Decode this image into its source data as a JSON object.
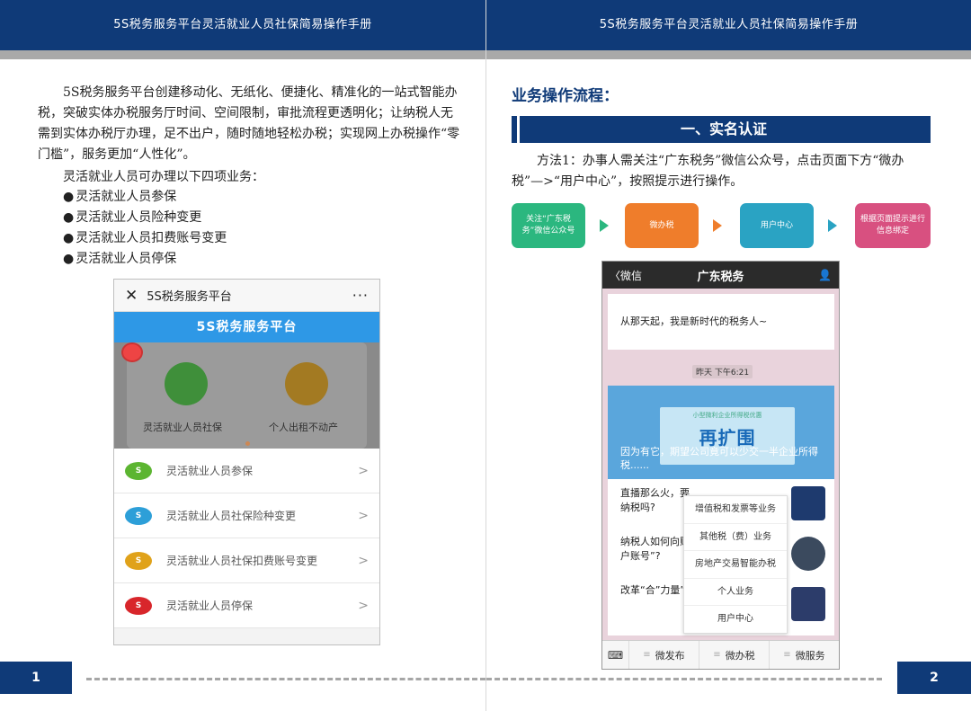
{
  "header": {
    "title": "5S税务服务平台灵活就业人员社保简易操作手册"
  },
  "left_page": {
    "intro": "5S税务服务平台创建移动化、无纸化、便捷化、精准化的一站式智能办税，突破实体办税服务厅时间、空间限制，审批流程更透明化；让纳税人无需到实体办税厅办理，足不出户，随时随地轻松办税；实现网上办税操作“零门槛”，服务更加“人性化”。",
    "lead": "灵活就业人员可办理以下四项业务：",
    "bullets": [
      "灵活就业人员参保",
      "灵活就业人员险种变更",
      "灵活就业人员扣费账号变更",
      "灵活就业人员停保"
    ],
    "page_number": "1"
  },
  "phone1": {
    "close": "✕",
    "title": "5S税务服务平台",
    "more": "···",
    "banner": "5S税务服务平台",
    "hero_labels": [
      "灵活就业人员社保",
      "个人出租不动产"
    ],
    "rows": [
      {
        "label": "灵活就业人员参保",
        "color": "#5cb531"
      },
      {
        "label": "灵活就业人员社保险种变更",
        "color": "#2d9fd8"
      },
      {
        "label": "灵活就业人员社保扣费账号变更",
        "color": "#e0a21a"
      },
      {
        "label": "灵活就业人员停保",
        "color": "#d8262b"
      }
    ]
  },
  "right_page": {
    "section_label": "业务操作流程：",
    "section_bar": "一、实名认证",
    "method": "方法1：办事人需关注“广东税务”微信公众号，点击页面下方“微办税”—>“用户中心”，按照提示进行操作。",
    "flow": [
      {
        "label": "关注“广东税务”微信公众号",
        "color": "#2bb77f"
      },
      {
        "label": "微办税",
        "color": "#ef7d2b"
      },
      {
        "label": "用户中心",
        "color": "#2aa3c3"
      },
      {
        "label": "根据页面提示进行信息绑定",
        "color": "#d85080"
      }
    ],
    "page_number": "2"
  },
  "phone2": {
    "back": "〈微信",
    "title": "广东税务",
    "user_icon": "user-icon",
    "msg1": "从那天起，我是新时代的税务人~",
    "time": "昨天 下午6:21",
    "promo_small": "小型微利企业所得税优惠",
    "promo_big": "再扩围",
    "news_caption": "因为有它，期望公司竟可以少交一半企业所得税......",
    "list": [
      "直播那么火，要纳税吗?",
      "纳税人如何向账户账号”?",
      "改革“合”力量”"
    ],
    "menu": [
      "增值税和发票等业务",
      "其他税（费）业务",
      "房地产交易智能办税",
      "个人业务",
      "用户中心"
    ],
    "footer": [
      "微发布",
      "微办税",
      "微服务"
    ]
  }
}
